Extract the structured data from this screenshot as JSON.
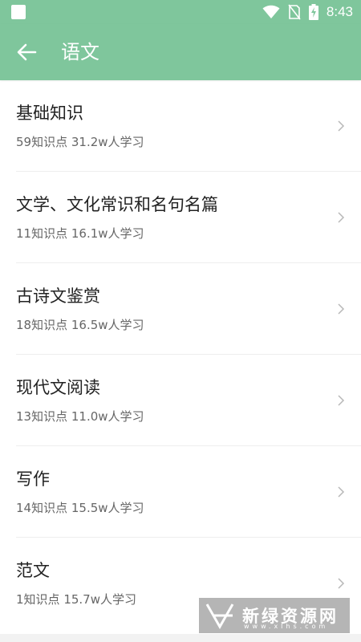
{
  "status_bar": {
    "time": "8:43",
    "icons": [
      "notification-square-icon",
      "wifi-icon",
      "no-sim-icon",
      "battery-charging-icon"
    ],
    "color": "#7fc69c"
  },
  "app_bar": {
    "title": "语文",
    "back_icon": "back-arrow-icon",
    "color": "#7fc69c"
  },
  "items": [
    {
      "title": "基础知识",
      "points": "59知识点",
      "learners": "31.2w人学习"
    },
    {
      "title": "文学、文化常识和名句名篇",
      "points": "11知识点",
      "learners": "16.1w人学习"
    },
    {
      "title": "古诗文鉴赏",
      "points": "18知识点",
      "learners": "16.5w人学习"
    },
    {
      "title": "现代文阅读",
      "points": "13知识点",
      "learners": "11.0w人学习"
    },
    {
      "title": "写作",
      "points": "14知识点",
      "learners": "15.5w人学习"
    },
    {
      "title": "范文",
      "points": "1知识点",
      "learners": "15.7w人学习"
    }
  ],
  "watermark": {
    "text": "新绿资源网",
    "sub": "www.xlhs.com"
  }
}
